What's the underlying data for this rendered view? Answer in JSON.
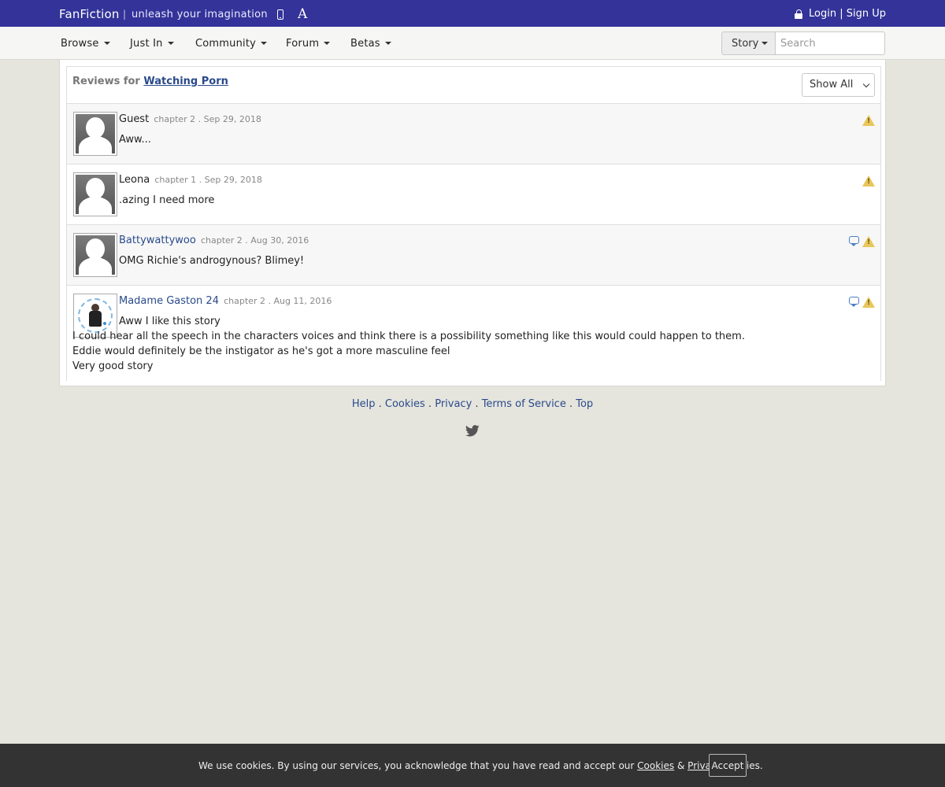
{
  "topbar": {
    "brand": "FanFiction",
    "separator": "|",
    "tagline": "unleash your imagination",
    "font_icon_glyph": "A",
    "login": "Login",
    "auth_separator": "|",
    "signup": "Sign Up",
    "bg_color": "#333399"
  },
  "nav": {
    "items": [
      "Browse",
      "Just In",
      "Community",
      "Forum",
      "Betas"
    ],
    "story_label": "Story",
    "search_placeholder": "Search"
  },
  "reviews": {
    "title_prefix": "Reviews for",
    "story_title": "Watching Porn",
    "filter_selected": "Show All",
    "items": [
      {
        "name": "Guest",
        "meta": "chapter 2 . Sep 29, 2018",
        "text": "Aww..."
      },
      {
        "name": "Leona",
        "meta": "chapter 1 . Sep 29, 2018",
        "text": ".azing I need more"
      },
      {
        "name": "Battywattywoo",
        "meta": "chapter 2 . Aug 30, 2016",
        "text": "OMG Richie's androgynous? Blimey!"
      },
      {
        "name": "Madame Gaston 24",
        "meta": "chapter 2 . Aug 11, 2016",
        "text": "Aww I like this story\nI could hear all the speech in the characters voices and think there is a possibility something like this would could happen to them.\nEddie would definitely be the instigator as he's got a more masculine feel\nVery good story"
      }
    ]
  },
  "footer": {
    "links": [
      "Help",
      "Cookies",
      "Privacy",
      "Terms of Service",
      "Top"
    ],
    "separator": "."
  },
  "cookie": {
    "msg_start": "We use cookies. By using our services, you acknowledge that you have read and accept our",
    "cookies_link": "Cookies",
    "amp": "&",
    "privacy_link": "Privacy",
    "msg_end": "Policies.",
    "accept": "Accept"
  }
}
